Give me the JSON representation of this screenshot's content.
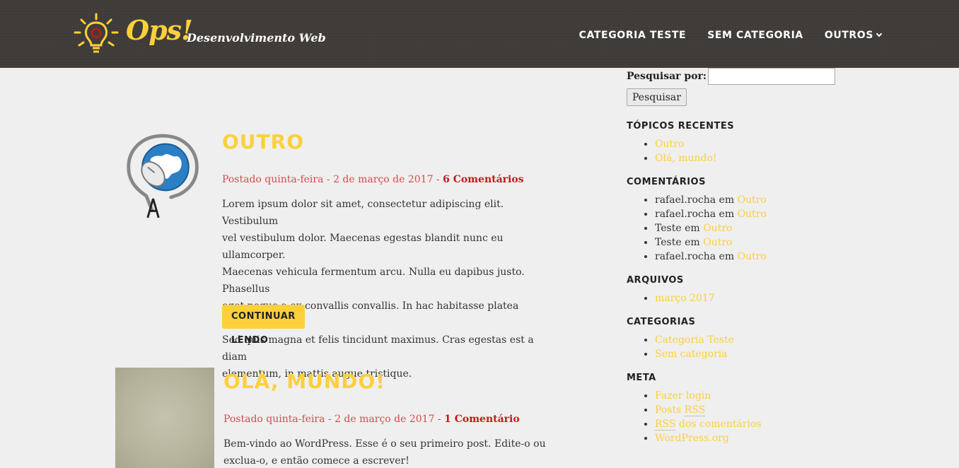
{
  "site": {
    "logo_title": "Ops!",
    "logo_subtitle": "Desenvolvimento Web"
  },
  "nav": {
    "items": [
      {
        "label": "CATEGORIA TESTE"
      },
      {
        "label": "SEM CATEGORIA"
      },
      {
        "label": "OUTROS"
      }
    ]
  },
  "posts": [
    {
      "title": "OUTRO",
      "meta": "Postado quinta-feira - 2 de março de 2017 - ",
      "comments": "6 Comentários",
      "body_lines": [
        "Lorem ipsum dolor sit amet, consectetur adipiscing elit. Vestibulum",
        "vel vestibulum dolor. Maecenas egestas blandit nunc eu ullamcorper.",
        "Maecenas vehicula fermentum arcu. Nulla eu dapibus justo. Phasellus",
        "eget neque a ex convallis convallis. In hac habitasse platea dictumst.",
        "Sed quis magna et felis tincidunt maximus. Cras egestas est a diam",
        "elementum, in mattis augue tristique."
      ],
      "button": "CONTINUAR LENDO"
    },
    {
      "title": "OLÁ, MUNDO!",
      "meta": "Postado quinta-feira - 2 de março de 2017 - ",
      "comments": "1 Comentário",
      "body_lines": [
        "Bem-vindo ao WordPress. Esse é o seu primeiro post. Edite-o ou",
        "exclua-o, e então comece a escrever!"
      ]
    }
  ],
  "sidebar": {
    "search_label": "Pesquisar por:",
    "search_value": "",
    "search_button": "Pesquisar",
    "recent_title": "TÓPICOS RECENTES",
    "recent_items": [
      "Outro",
      "Olá, mundo!"
    ],
    "comments_title": "COMENTÁRIOS",
    "comments_items": [
      {
        "author": "rafael.rocha",
        "sep": " em ",
        "post": "Outro"
      },
      {
        "author": "rafael.rocha",
        "sep": " em ",
        "post": "Outro"
      },
      {
        "author": "Teste",
        "sep": " em ",
        "post": "Outro"
      },
      {
        "author": "Teste",
        "sep": " em ",
        "post": "Outro"
      },
      {
        "author": "rafael.rocha",
        "sep": " em ",
        "post": "Outro"
      }
    ],
    "archives_title": "ARQUIVOS",
    "archives_items": [
      "março 2017"
    ],
    "categories_title": "CATEGORIAS",
    "categories_items": [
      "Categoria Teste",
      "Sem categoria"
    ],
    "meta_title": "META",
    "meta_login": "Fazer login",
    "meta_posts": "Posts ",
    "meta_posts_rss": "RSS",
    "meta_comments_rss": "RSS",
    "meta_comments": " dos comentários",
    "meta_wordpress": "WordPress.org"
  },
  "colors": {
    "accent": "#fdd03b",
    "header_bg": "#3f3b38",
    "page_bg": "#efefef",
    "meta_red": "#d64b4b"
  }
}
